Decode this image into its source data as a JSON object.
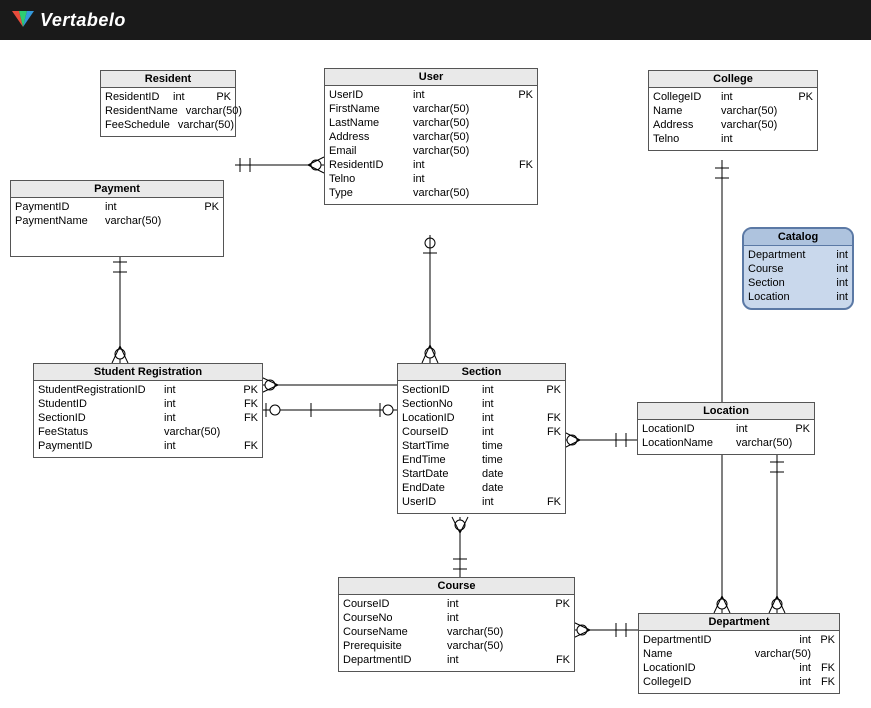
{
  "brand": "Vertabelo",
  "entities": {
    "resident": {
      "title": "Resident",
      "rows": [
        {
          "name": "ResidentID",
          "type": "int",
          "key": "PK"
        },
        {
          "name": "ResidentName",
          "type": "varchar(50)",
          "key": ""
        },
        {
          "name": "FeeSchedule",
          "type": "varchar(50)",
          "key": ""
        }
      ]
    },
    "user": {
      "title": "User",
      "rows": [
        {
          "name": "UserID",
          "type": "int",
          "key": "PK"
        },
        {
          "name": "FirstName",
          "type": "varchar(50)",
          "key": ""
        },
        {
          "name": "LastName",
          "type": "varchar(50)",
          "key": ""
        },
        {
          "name": "Address",
          "type": "varchar(50)",
          "key": ""
        },
        {
          "name": "Email",
          "type": "varchar(50)",
          "key": ""
        },
        {
          "name": "ResidentID",
          "type": "int",
          "key": "FK"
        },
        {
          "name": "Telno",
          "type": "int",
          "key": ""
        },
        {
          "name": "Type",
          "type": "varchar(50)",
          "key": ""
        }
      ]
    },
    "college": {
      "title": "College",
      "rows": [
        {
          "name": "CollegeID",
          "type": "int",
          "key": "PK"
        },
        {
          "name": "Name",
          "type": "varchar(50)",
          "key": ""
        },
        {
          "name": "Address",
          "type": "varchar(50)",
          "key": ""
        },
        {
          "name": "Telno",
          "type": "int",
          "key": ""
        }
      ]
    },
    "payment": {
      "title": "Payment",
      "rows": [
        {
          "name": "PaymentID",
          "type": "int",
          "key": "PK"
        },
        {
          "name": "PaymentName",
          "type": "varchar(50)",
          "key": ""
        }
      ]
    },
    "student_registration": {
      "title": "Student Registration",
      "rows": [
        {
          "name": "StudentRegistrationID",
          "type": "int",
          "key": "PK"
        },
        {
          "name": "StudentID",
          "type": "int",
          "key": "FK"
        },
        {
          "name": "SectionID",
          "type": "int",
          "key": "FK"
        },
        {
          "name": "FeeStatus",
          "type": "varchar(50)",
          "key": ""
        },
        {
          "name": "PaymentID",
          "type": "int",
          "key": "FK"
        }
      ]
    },
    "section": {
      "title": "Section",
      "rows": [
        {
          "name": "SectionID",
          "type": "int",
          "key": "PK"
        },
        {
          "name": "SectionNo",
          "type": "int",
          "key": ""
        },
        {
          "name": "LocationID",
          "type": "int",
          "key": "FK"
        },
        {
          "name": "CourseID",
          "type": "int",
          "key": "FK"
        },
        {
          "name": "StartTime",
          "type": "time",
          "key": ""
        },
        {
          "name": "EndTime",
          "type": "time",
          "key": ""
        },
        {
          "name": "StartDate",
          "type": "date",
          "key": ""
        },
        {
          "name": "EndDate",
          "type": "date",
          "key": ""
        },
        {
          "name": "UserID",
          "type": "int",
          "key": "FK"
        }
      ]
    },
    "location": {
      "title": "Location",
      "rows": [
        {
          "name": "LocationID",
          "type": "int",
          "key": "PK"
        },
        {
          "name": "LocationName",
          "type": "varchar(50)",
          "key": ""
        }
      ]
    },
    "course": {
      "title": "Course",
      "rows": [
        {
          "name": "CourseID",
          "type": "int",
          "key": "PK"
        },
        {
          "name": "CourseNo",
          "type": "int",
          "key": ""
        },
        {
          "name": "CourseName",
          "type": "varchar(50)",
          "key": ""
        },
        {
          "name": "Prerequisite",
          "type": "varchar(50)",
          "key": ""
        },
        {
          "name": "DepartmentID",
          "type": "int",
          "key": "FK"
        }
      ]
    },
    "department": {
      "title": "Department",
      "rows": [
        {
          "name": "DepartmentID",
          "type": "int",
          "key": "PK"
        },
        {
          "name": "Name",
          "type": "varchar(50)",
          "key": ""
        },
        {
          "name": "LocationID",
          "type": "int",
          "key": "FK"
        },
        {
          "name": "CollegeID",
          "type": "int",
          "key": "FK"
        }
      ]
    }
  },
  "views": {
    "catalog": {
      "title": "Catalog",
      "rows": [
        {
          "name": "Department",
          "type": "int"
        },
        {
          "name": "Course",
          "type": "int"
        },
        {
          "name": "Section",
          "type": "int"
        },
        {
          "name": "Location",
          "type": "int"
        }
      ]
    }
  }
}
